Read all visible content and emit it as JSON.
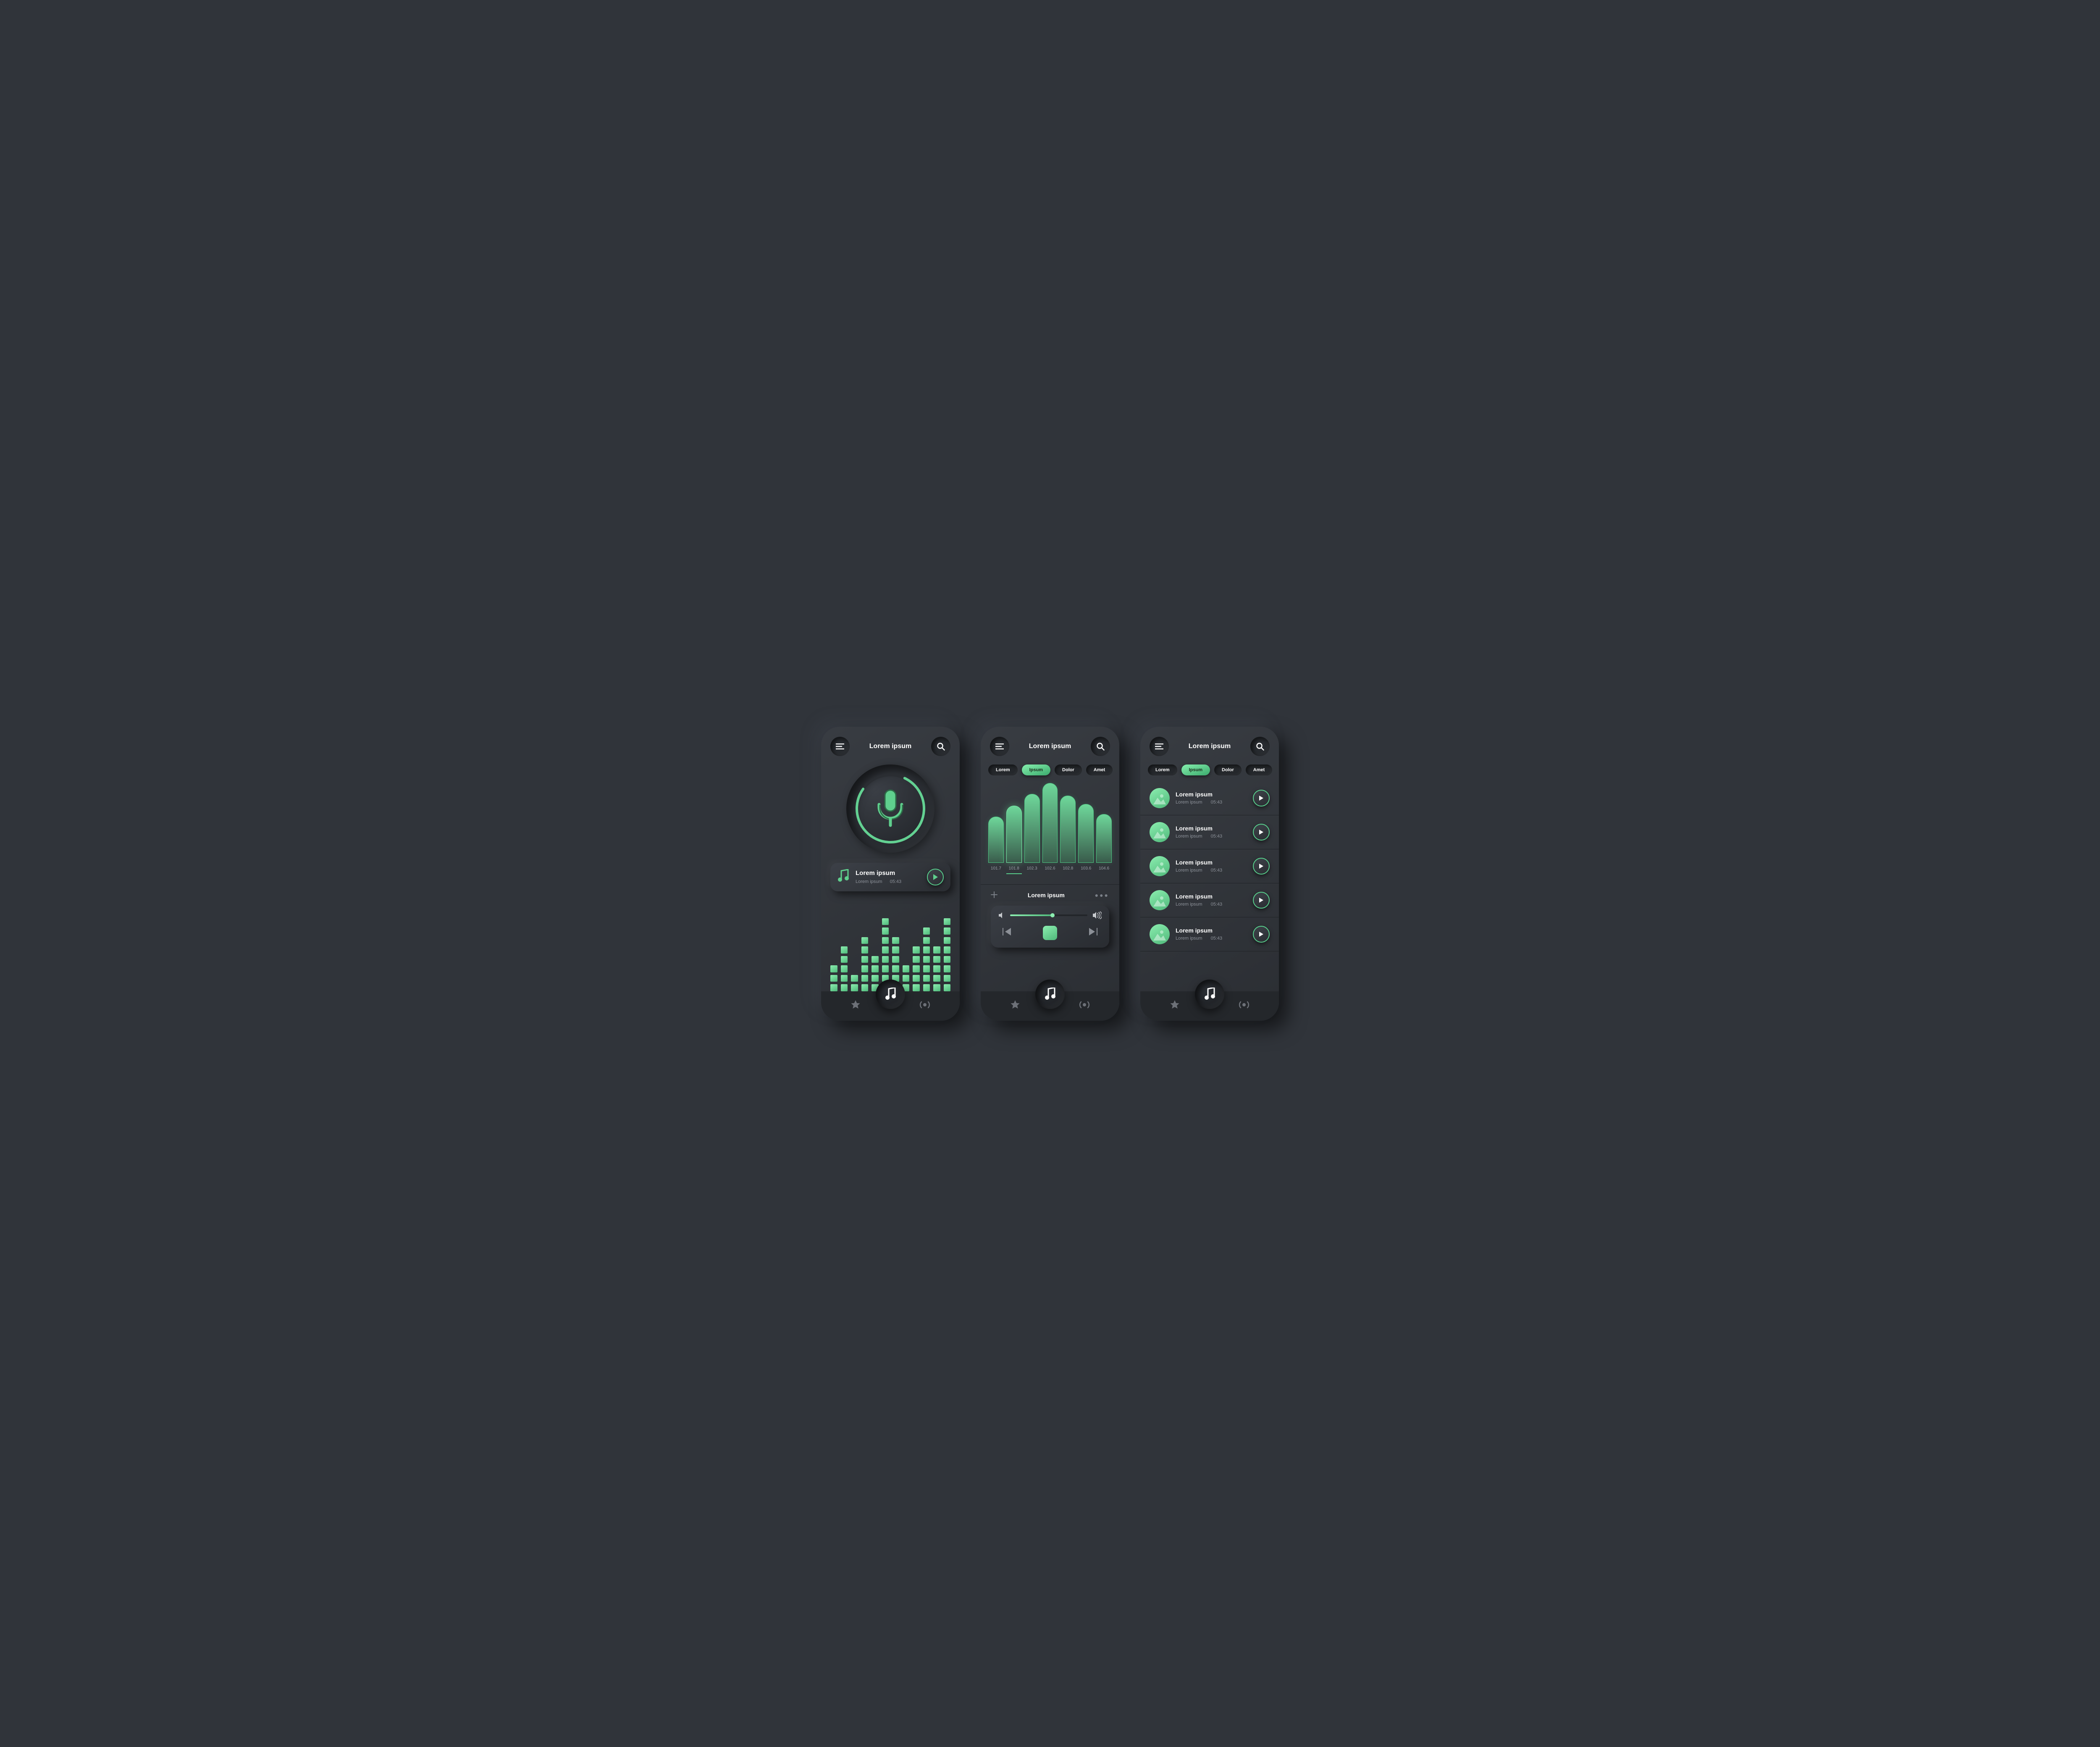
{
  "accent": "#63d192",
  "header": {
    "title": "Lorem ipsum"
  },
  "tabs": [
    {
      "label": "Lorem",
      "active": false
    },
    {
      "label": "Ipsum",
      "active": true
    },
    {
      "label": "Dolor",
      "active": false
    },
    {
      "label": "Amet",
      "active": false
    }
  ],
  "screen1": {
    "now_playing": {
      "title": "Lorem ipsum",
      "subtitle": "Lorem ipsum",
      "time": "05:43"
    },
    "eq_heights": [
      3,
      5,
      2,
      6,
      4,
      8,
      6,
      3,
      5,
      7,
      5,
      8
    ]
  },
  "screen2": {
    "player_title": "Lorem ipsum"
  },
  "chart_data": {
    "type": "bar",
    "categories": [
      "101.7",
      "101.8",
      "102.3",
      "102.6",
      "102.8",
      "103.6",
      "104.6"
    ],
    "values": [
      55,
      68,
      82,
      95,
      80,
      70,
      58
    ],
    "selected_index": 1,
    "title": "",
    "xlabel": "",
    "ylabel": "",
    "ylim": [
      0,
      100
    ]
  },
  "screen3": {
    "tracks": [
      {
        "title": "Lorem ipsum",
        "subtitle": "Lorem ipsum",
        "time": "05:43"
      },
      {
        "title": "Lorem ipsum",
        "subtitle": "Lorem ipsum",
        "time": "05:43"
      },
      {
        "title": "Lorem ipsum",
        "subtitle": "Lorem ipsum",
        "time": "05:43"
      },
      {
        "title": "Lorem ipsum",
        "subtitle": "Lorem ipsum",
        "time": "05:43"
      },
      {
        "title": "Lorem ipsum",
        "subtitle": "Lorem ipsum",
        "time": "05:43"
      }
    ]
  },
  "icons": {
    "menu": "menu-icon",
    "search": "search-icon",
    "mic": "microphone-icon",
    "note": "music-note-icon",
    "play": "play-icon",
    "star": "star-icon",
    "broadcast": "broadcast-icon",
    "image": "image-icon",
    "volume_low": "volume-low-icon",
    "volume_high": "volume-high-icon",
    "prev": "skip-previous-icon",
    "next": "skip-next-icon",
    "stop": "stop-icon",
    "plus": "plus-icon",
    "more": "more-icon"
  }
}
